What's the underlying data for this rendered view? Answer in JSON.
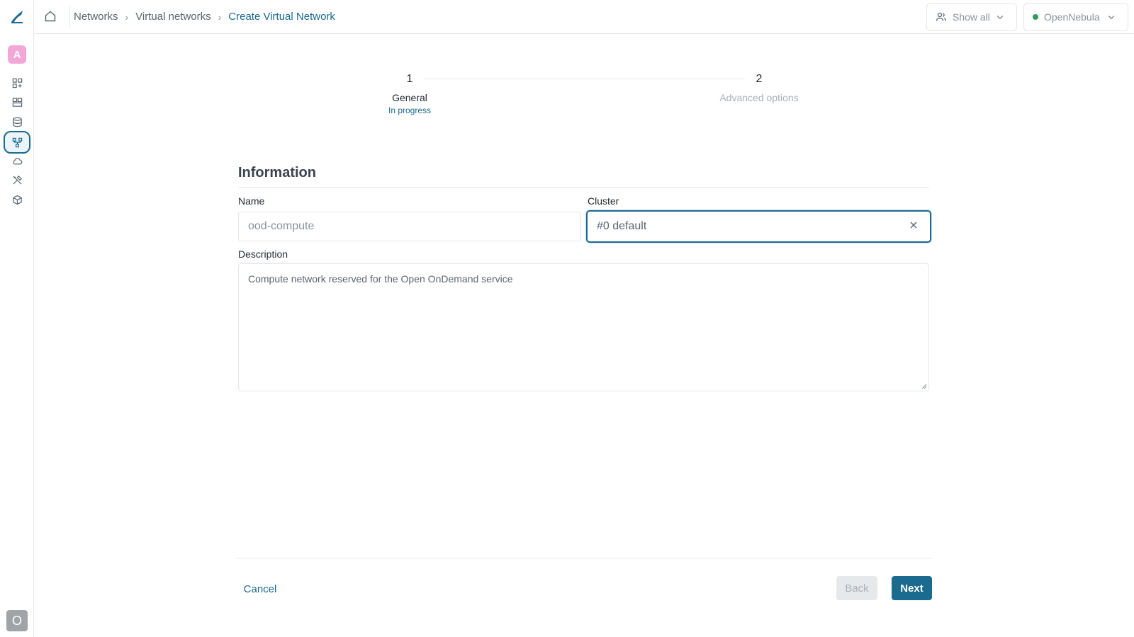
{
  "sidebar": {
    "group_initial": "A",
    "user_initial": "O",
    "items": [
      {
        "icon": "dashboard-add-icon"
      },
      {
        "icon": "templates-icon"
      },
      {
        "icon": "storage-icon"
      },
      {
        "icon": "network-icon",
        "active": true
      },
      {
        "icon": "cloud-icon"
      },
      {
        "icon": "tools-icon"
      },
      {
        "icon": "cube-icon"
      }
    ]
  },
  "header": {
    "breadcrumb": [
      "Networks",
      "Virtual networks",
      "Create Virtual Network"
    ],
    "group_filter": "Show all",
    "zone": "OpenNebula"
  },
  "stepper": {
    "steps": [
      {
        "number": "1",
        "label": "General",
        "status": "In progress"
      },
      {
        "number": "2",
        "label": "Advanced options"
      }
    ]
  },
  "form": {
    "section_title": "Information",
    "name_label": "Name",
    "name_value": "ood-compute",
    "cluster_label": "Cluster",
    "cluster_value": "#0 default",
    "description_label": "Description",
    "description_value": "Compute network reserved for the Open OnDemand service"
  },
  "footer": {
    "cancel": "Cancel",
    "back": "Back",
    "next": "Next"
  },
  "colors": {
    "accent": "#1b6a8f",
    "status_online": "#2e9e55",
    "group_avatar": "#f3a6d8"
  }
}
